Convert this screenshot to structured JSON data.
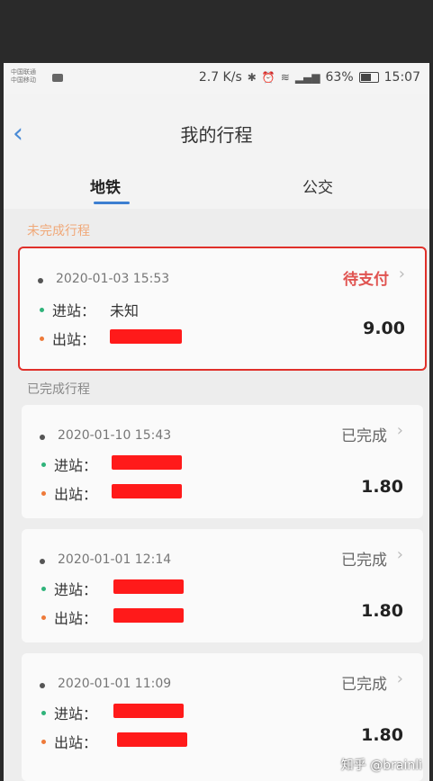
{
  "status_bar": {
    "carrier_line1": "中国联通",
    "carrier_line2": "中国移动",
    "speed": "2.7 K/s",
    "bluetooth_icon": "bluetooth-icon",
    "alarm_icon": "alarm-icon",
    "wifi_icon": "wifi-icon",
    "signal_icon": "signal-icon",
    "battery": "63%",
    "time": "15:07"
  },
  "header": {
    "back_glyph": "‹",
    "title": "我的行程"
  },
  "tabs": [
    {
      "label": "地铁",
      "active": true
    },
    {
      "label": "公交",
      "active": false
    }
  ],
  "sections": {
    "incomplete_label": "未完成行程",
    "completed_label": "已完成行程"
  },
  "trips": [
    {
      "date": "2020-01-03 15:53",
      "status": "待支付",
      "entry_label": "进站：",
      "entry_value": "未知",
      "exit_label": "出站：",
      "amount": "9.00"
    },
    {
      "date": "2020-01-10 15:43",
      "status": "已完成",
      "entry_label": "进站：",
      "exit_label": "出站：",
      "amount": "1.80"
    },
    {
      "date": "2020-01-01 12:14",
      "status": "已完成",
      "entry_label": "进站：",
      "exit_label": "出站：",
      "amount": "1.80"
    },
    {
      "date": "2020-01-01 11:09",
      "status": "已完成",
      "entry_label": "进站：",
      "exit_label": "出站：",
      "amount": "1.80"
    }
  ],
  "colors": {
    "accent": "#3d7fd1",
    "pending": "#e05350",
    "highlight_border": "#e0302a",
    "redaction": "#ff1a1a"
  },
  "watermark": "知乎 @brainli"
}
